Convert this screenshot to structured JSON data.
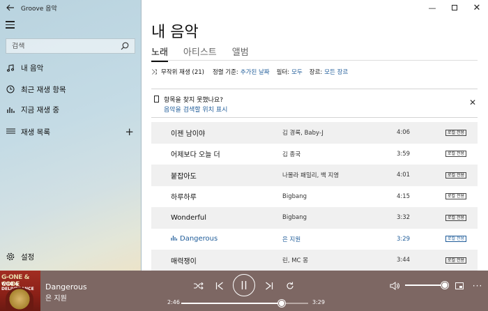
{
  "window": {
    "app_title": "Groove 음악"
  },
  "sidebar": {
    "search_placeholder": "검색",
    "items": [
      {
        "label": "내 음악",
        "icon": "music-note-icon"
      },
      {
        "label": "최근 재생 항목",
        "icon": "clock-icon"
      },
      {
        "label": "지금 재생 중",
        "icon": "equalizer-icon"
      },
      {
        "label": "재생 목록",
        "icon": "playlist-icon"
      }
    ],
    "settings_label": "설정"
  },
  "main": {
    "title": "내 음악",
    "tabs": [
      {
        "label": "노래",
        "active": true
      },
      {
        "label": "아티스트",
        "active": false
      },
      {
        "label": "앨범",
        "active": false
      }
    ],
    "filters": {
      "shuffle_label": "무작위 재생 (21)",
      "sort_label": "정렬 기준:",
      "sort_value": "추가된 날짜",
      "filter_label": "필터:",
      "filter_value": "모두",
      "genre_label": "장르:",
      "genre_value": "모든 장르"
    },
    "notice": {
      "line1": "항목을 찾지 못했나요?",
      "line2": "음악을 검색할 위치 표시"
    },
    "songs": [
      {
        "title": "이젠 남이야",
        "artist": "김 경록, Baby-J",
        "duration": "4:06",
        "badge": "로컬 전용",
        "playing": false
      },
      {
        "title": "어제보다 오늘 더",
        "artist": "김 종국",
        "duration": "3:59",
        "badge": "로컬 전용",
        "playing": false
      },
      {
        "title": "붙잡아도",
        "artist": "나몰라 패밀리, 백 지영",
        "duration": "4:01",
        "badge": "로컬 전용",
        "playing": false
      },
      {
        "title": "하루하루",
        "artist": "Bigbang",
        "duration": "4:15",
        "badge": "로컬 전용",
        "playing": false
      },
      {
        "title": "Wonderful",
        "artist": "Bigbang",
        "duration": "3:32",
        "badge": "로컬 전용",
        "playing": false
      },
      {
        "title": "Dangerous",
        "artist": "은 지원",
        "duration": "3:29",
        "badge": "로컬 전용",
        "playing": true
      },
      {
        "title": "매력쟁이",
        "artist": "린, MC 몽",
        "duration": "3:44",
        "badge": "로컬 전용",
        "playing": false
      }
    ]
  },
  "player": {
    "title": "Dangerous",
    "artist": "은 지원",
    "elapsed": "2:46",
    "total": "3:29",
    "progress_fraction": 0.79,
    "volume_fraction": 1.0,
    "album_art_text_1": "G-ONE & CODE",
    "album_art_text_2": "WILD & DELIVERANCE"
  },
  "colors": {
    "accent": "#1f5c99",
    "player_bg": "#7d6763"
  }
}
